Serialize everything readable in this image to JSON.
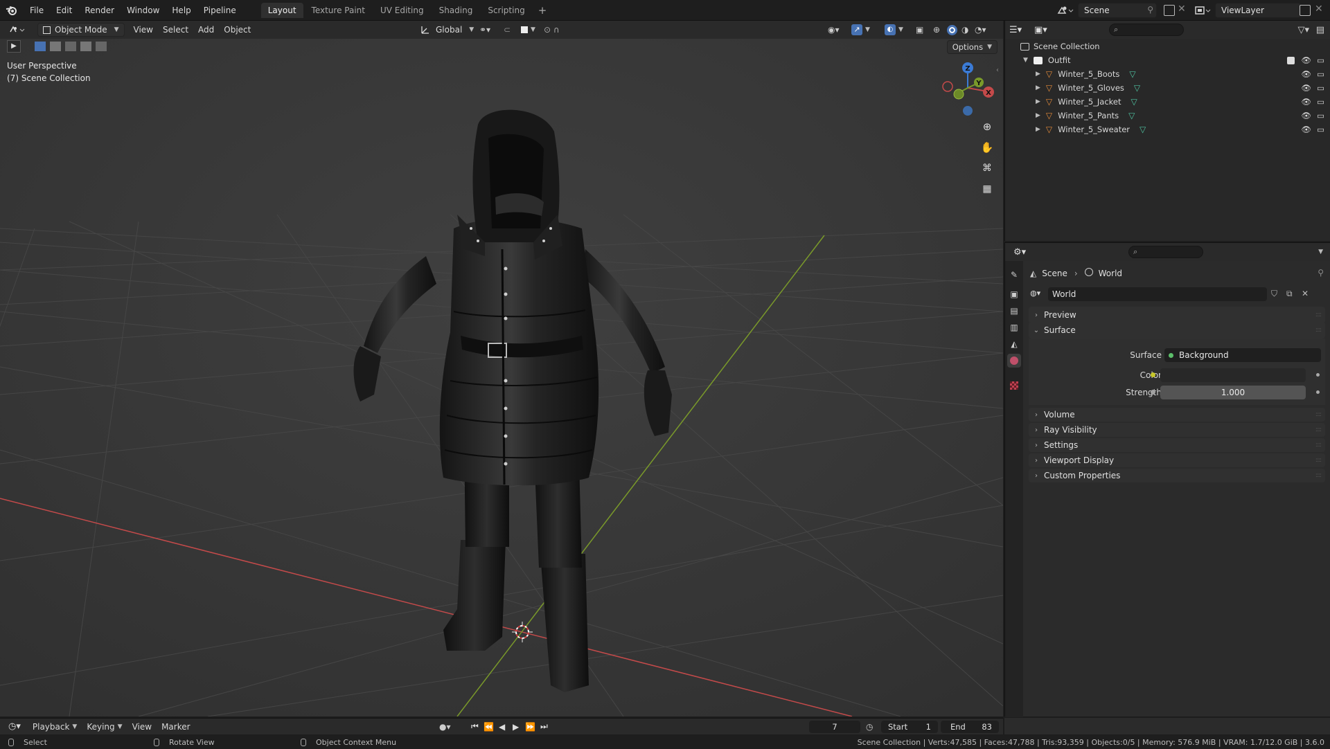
{
  "menubar": {
    "items": [
      "File",
      "Edit",
      "Render",
      "Window",
      "Help",
      "Pipeline"
    ],
    "workspaces": [
      "Layout",
      "Texture Paint",
      "UV Editing",
      "Shading",
      "Scripting"
    ],
    "active_workspace": "Layout",
    "scene_name": "Scene",
    "view_layer": "ViewLayer"
  },
  "viewport": {
    "mode": "Object Mode",
    "menus": [
      "View",
      "Select",
      "Add",
      "Object"
    ],
    "transform_orientation": "Global",
    "options_label": "Options",
    "perspective_label": "User Perspective",
    "collection_label": "(7) Scene Collection",
    "gizmo_axes": [
      "X",
      "Y",
      "Z"
    ]
  },
  "outliner": {
    "root": "Scene Collection",
    "collection": "Outfit",
    "objects": [
      "Winter_5_Boots",
      "Winter_5_Gloves",
      "Winter_5_Jacket",
      "Winter_5_Pants",
      "Winter_5_Sweater"
    ]
  },
  "properties": {
    "breadcrumb": [
      "Scene",
      "World"
    ],
    "world_name": "World",
    "panels_top": [
      "Preview",
      "Surface"
    ],
    "surface": {
      "surface_label": "Surface",
      "surface_value": "Background",
      "color_label": "Color",
      "strength_label": "Strength",
      "strength_value": "1.000"
    },
    "panels_bottom": [
      "Volume",
      "Ray Visibility",
      "Settings",
      "Viewport Display",
      "Custom Properties"
    ]
  },
  "timeline": {
    "menus": [
      "Playback",
      "Keying",
      "View",
      "Marker"
    ],
    "current_frame": "7",
    "start_label": "Start",
    "start_value": "1",
    "end_label": "End",
    "end_value": "83"
  },
  "statusbar": {
    "hints": [
      "Select",
      "Rotate View",
      "Object Context Menu"
    ],
    "stats": "Scene Collection | Verts:47,585 | Faces:47,788 | Tris:93,359 | Objects:0/5 | Memory: 576.9 MiB | VRAM: 1.7/12.0 GiB | 3.6.0"
  },
  "colors": {
    "accent_blue": "#4772b3",
    "axis_x": "#c44a4a",
    "axis_y": "#7a9a2a",
    "axis_z": "#3b7bd6",
    "mesh_icon": "#e38a3a",
    "data_icon": "#4fc3a1"
  }
}
